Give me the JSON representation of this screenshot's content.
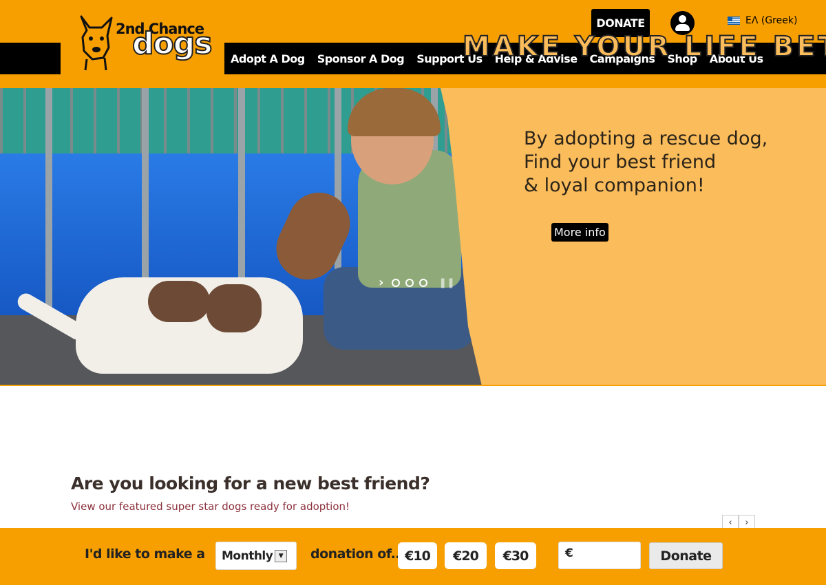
{
  "header": {
    "logo": {
      "line1": "2nd Chance",
      "line2": "dogs"
    },
    "donate_label": "DONATE",
    "account_icon": "user-circle-icon",
    "language": {
      "flag": "greek-flag",
      "label": "ΕΛ (Greek)"
    },
    "nav": [
      {
        "label": "Adopt A Dog"
      },
      {
        "label": "Sponsor A Dog"
      },
      {
        "label": "Support Us"
      },
      {
        "label": "Help & Advise"
      },
      {
        "label": "Campaigns"
      },
      {
        "label": "Shop"
      },
      {
        "label": "About Us"
      }
    ]
  },
  "hero": {
    "title": "MAKE YOUR LIFE BETTER",
    "text_line1": "By adopting a rescue dog,",
    "text_line2": "Find your best friend",
    "text_line3": "& loyal companion!",
    "more_info_label": "More info",
    "slider": {
      "next_icon": "chevron-right-icon",
      "dots": 3,
      "pause_icon": "pause-icon"
    }
  },
  "featured": {
    "title": "Are you looking for a new best friend?",
    "subtitle": "View our featured super star dogs ready for adoption!",
    "prev_label": "‹",
    "next_label": "›"
  },
  "donation_bar": {
    "prefix": "I'd like to make a",
    "frequency": "Monthly",
    "mid": "donation of...",
    "amounts": [
      "€10",
      "€20",
      "€30"
    ],
    "currency_symbol": "€",
    "custom_amount": "",
    "donate_label": "Donate"
  },
  "colors": {
    "brand_orange": "#f79f00",
    "hero_panel": "#fbbc5c",
    "nav_black": "#000000",
    "subtitle_red": "#8b2f3a"
  }
}
